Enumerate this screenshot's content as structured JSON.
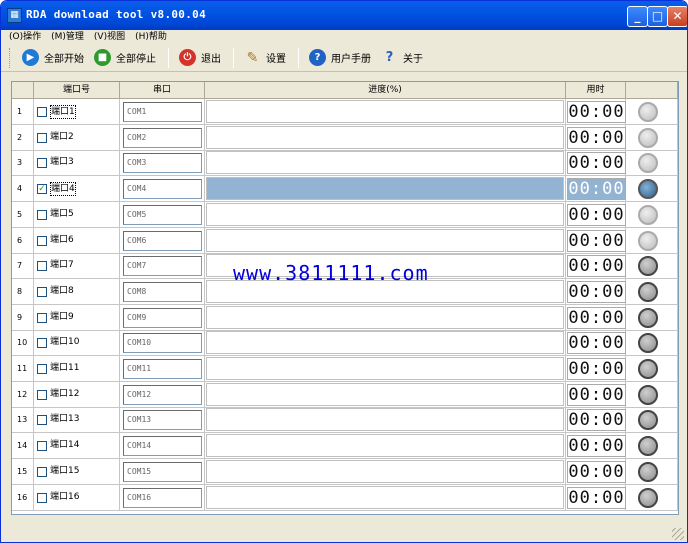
{
  "window": {
    "title": "RDA download tool v8.00.04",
    "minimize": "_",
    "maximize": "□",
    "close": "✕"
  },
  "menu": [
    "(O)操作",
    "(M)管理",
    "(V)视图",
    "(H)帮助"
  ],
  "toolbar": {
    "start_all": "全部开始",
    "stop_all": "全部停止",
    "exit": "退出",
    "settings": "设置",
    "manual": "用户手册",
    "about": "关于"
  },
  "table": {
    "headers": {
      "port": "端口号",
      "serial": "串口",
      "progress": "进度(%)",
      "time": "用时"
    },
    "rows": [
      {
        "n": "1",
        "port": "端口1",
        "com": "COM1",
        "checked": false,
        "time": "00:00",
        "status": "light"
      },
      {
        "n": "2",
        "port": "端口2",
        "com": "COM2",
        "checked": false,
        "time": "00:00",
        "status": "light"
      },
      {
        "n": "3",
        "port": "端口3",
        "com": "COM3",
        "checked": false,
        "time": "00:00",
        "status": "light"
      },
      {
        "n": "4",
        "port": "端口4",
        "com": "COM4",
        "checked": true,
        "time": "00:00",
        "status": "active"
      },
      {
        "n": "5",
        "port": "端口5",
        "com": "COM5",
        "checked": false,
        "time": "00:00",
        "status": "light"
      },
      {
        "n": "6",
        "port": "端口6",
        "com": "COM6",
        "checked": false,
        "time": "00:00",
        "status": "light"
      },
      {
        "n": "7",
        "port": "端口7",
        "com": "COM7",
        "checked": false,
        "time": "00:00",
        "status": "dark"
      },
      {
        "n": "8",
        "port": "端口8",
        "com": "COM8",
        "checked": false,
        "time": "00:00",
        "status": "dark"
      },
      {
        "n": "9",
        "port": "端口9",
        "com": "COM9",
        "checked": false,
        "time": "00:00",
        "status": "dark"
      },
      {
        "n": "10",
        "port": "端口10",
        "com": "COM10",
        "checked": false,
        "time": "00:00",
        "status": "dark"
      },
      {
        "n": "11",
        "port": "端口11",
        "com": "COM11",
        "checked": false,
        "time": "00:00",
        "status": "dark"
      },
      {
        "n": "12",
        "port": "端口12",
        "com": "COM12",
        "checked": false,
        "time": "00:00",
        "status": "dark"
      },
      {
        "n": "13",
        "port": "端口13",
        "com": "COM13",
        "checked": false,
        "time": "00:00",
        "status": "dark"
      },
      {
        "n": "14",
        "port": "端口14",
        "com": "COM14",
        "checked": false,
        "time": "00:00",
        "status": "dark"
      },
      {
        "n": "15",
        "port": "端口15",
        "com": "COM15",
        "checked": false,
        "time": "00:00",
        "status": "dark"
      },
      {
        "n": "16",
        "port": "端口16",
        "com": "COM16",
        "checked": false,
        "time": "00:00",
        "status": "dark"
      }
    ]
  },
  "watermark": "www.3811111.com",
  "colors": {
    "titlebar": "#0054e3",
    "selected_row": "#93b3d2",
    "watermark": "#0000dd"
  }
}
